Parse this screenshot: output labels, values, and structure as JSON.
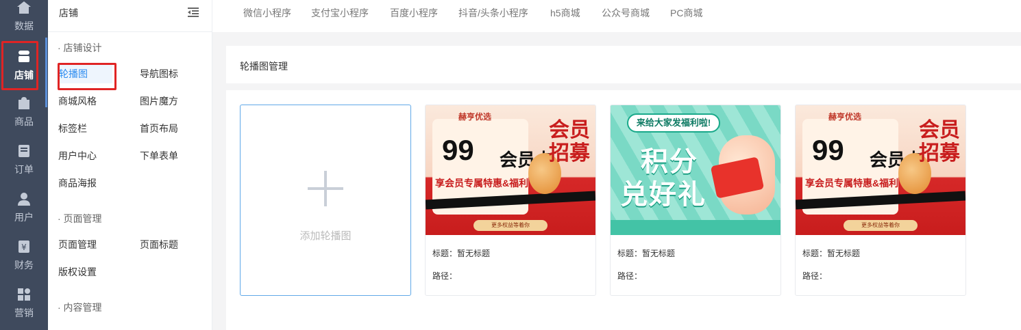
{
  "rail": {
    "items": [
      {
        "label": "数据",
        "icon": "home-icon"
      },
      {
        "label": "店铺",
        "icon": "store-icon",
        "active": true
      },
      {
        "label": "商品",
        "icon": "bag-icon"
      },
      {
        "label": "订单",
        "icon": "order-icon"
      },
      {
        "label": "用户",
        "icon": "user-icon"
      },
      {
        "label": "财务",
        "icon": "finance-icon"
      },
      {
        "label": "营销",
        "icon": "marketing-icon"
      }
    ]
  },
  "submenu": {
    "title": "店铺",
    "collapse_icon": "menu-collapse-icon",
    "groups": [
      {
        "title": "· 店铺设计"
      },
      {
        "title": "· 页面管理"
      },
      {
        "title": "· 内容管理"
      }
    ],
    "links": {
      "carousel": "轮播图",
      "nav_icon": "导航图标",
      "mall_style": "商城风格",
      "image_magic": "图片魔方",
      "tab_bar": "标签栏",
      "home_layout": "首页布局",
      "user_center": "用户中心",
      "order_form": "下单表单",
      "product_poster": "商品海报",
      "page_manage": "页面管理",
      "page_title": "页面标题",
      "copyright": "版权设置"
    }
  },
  "topbar": {
    "tabs": [
      "微信小程序",
      "支付宝小程序",
      "百度小程序",
      "抖音/头条小程序",
      "h5商城",
      "公众号商城",
      "PC商城"
    ]
  },
  "panel": {
    "title": "轮播图管理",
    "add_label": "添加轮播图",
    "cards": [
      {
        "title_label": "标题：暂无标题",
        "path_label": "路径：",
        "banner": "a"
      },
      {
        "title_label": "标题：暂无标题",
        "path_label": "路径：",
        "banner": "b"
      },
      {
        "title_label": "标题：暂无标题",
        "path_label": "路径：",
        "banner": "a"
      }
    ]
  },
  "bannerA": {
    "logo": "赫亨优选",
    "num": "99",
    "card_text": "会员卡",
    "sub": "享会员专属特惠&福利",
    "stamp": "会员招募",
    "btn": "更多权益等着你"
  },
  "bannerB": {
    "bubble": "来给大家发福利啦!",
    "line1": "积分",
    "line2": "兑好礼"
  },
  "colors": {
    "rail_bg": "#3f4a5d",
    "accent": "#2d8cf0",
    "highlight_box": "#e02424"
  }
}
